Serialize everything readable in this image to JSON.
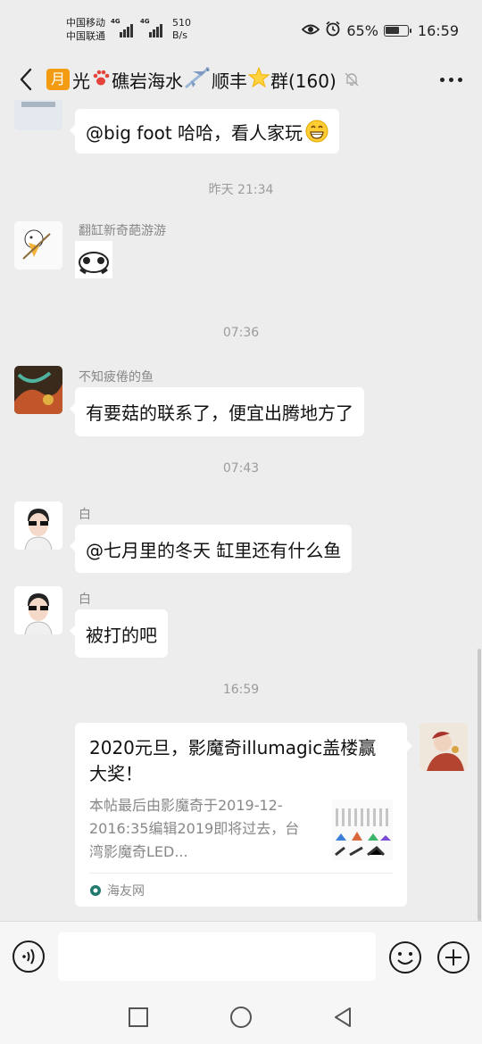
{
  "status_bar": {
    "carrier_1": "中国移动",
    "carrier_2": "中国联通",
    "network_1": "4G",
    "network_2": "4G",
    "speed_value": "510",
    "speed_unit": "B/s",
    "battery_text": "65%",
    "battery_level": 0.65,
    "time": "16:59"
  },
  "header": {
    "title_badge": "月",
    "title_part_1": "光",
    "title_part_2": "礁岩海水",
    "title_part_3": "顺丰",
    "title_part_4": "群(160)"
  },
  "messages": [
    {
      "type": "text",
      "text": "@big foot  哈哈，看人家玩",
      "emoji": "😁"
    },
    {
      "type": "time",
      "text": "昨天 21:34"
    },
    {
      "type": "sticker",
      "sender": "翻缸新奇葩游游"
    },
    {
      "type": "time",
      "text": "07:36"
    },
    {
      "type": "text",
      "sender": "不知疲倦的鱼",
      "text": "有要菇的联系了，便宜出腾地方了"
    },
    {
      "type": "time",
      "text": "07:43"
    },
    {
      "type": "text",
      "sender": "白",
      "text": "@七月里的冬天  缸里还有什么鱼"
    },
    {
      "type": "text",
      "sender": "白",
      "text": "被打的吧"
    },
    {
      "type": "time",
      "text": "16:59"
    }
  ],
  "link_card": {
    "title": "2020元旦，影魔奇illumagic盖楼赢大奖！",
    "description": "本帖最后由影魔奇于2019-12-2016:35编辑2019即将过去，台湾影魔奇LED...",
    "source": "海友网"
  },
  "input": {
    "placeholder": ""
  },
  "icons": {
    "back": "chevron-left-icon",
    "mute": "bell-off-icon",
    "more": "more-dots-icon",
    "voice": "voice-icon",
    "emoji": "emoji-icon",
    "plus": "plus-icon"
  },
  "colors": {
    "background": "#ededed",
    "bubble": "#ffffff",
    "badge_orange": "#f39c12",
    "muted_text": "#888888"
  }
}
